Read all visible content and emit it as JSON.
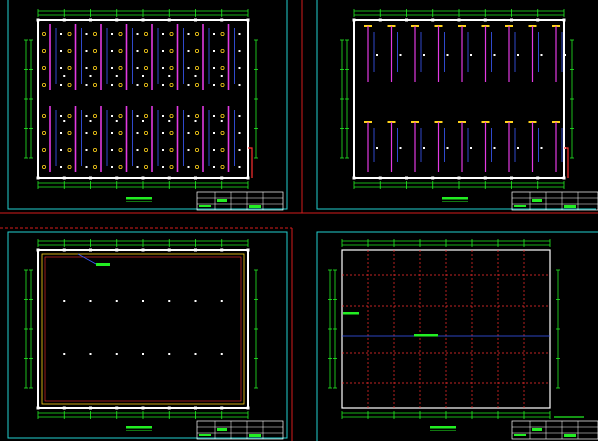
{
  "colors": {
    "background": "#000000",
    "sheet_border": "#d41c1c",
    "viewport_frame": "#22cfcf",
    "building_outline": "#ffffff",
    "dimension_line": "#22ee22",
    "pipe_main": "#e23ae2",
    "pipe_branch": "#3b5cff",
    "valve": "#ffd21a",
    "column_grid": "#ff3030",
    "title_block": "#ffffff",
    "title_block_fill": "#22ee22"
  },
  "sheets": [
    {
      "name": "sheet-top-left",
      "variant": "sprinkler-vertical"
    },
    {
      "name": "sheet-top-right",
      "variant": "sprinkler-branch"
    },
    {
      "name": "sheet-bottom-left",
      "variant": "perimeter-pipe",
      "selected": true
    },
    {
      "name": "sheet-bottom-right",
      "variant": "column-grid"
    }
  ]
}
